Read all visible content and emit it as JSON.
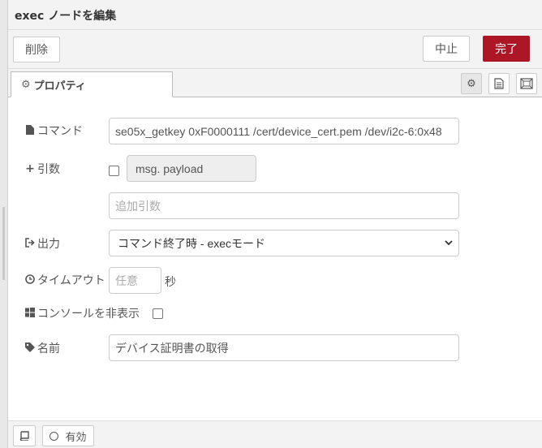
{
  "dialog": {
    "title": "exec ノードを編集"
  },
  "toolbar": {
    "delete_label": "削除",
    "cancel_label": "中止",
    "done_label": "完了"
  },
  "tabs": {
    "properties_label": "プロパティ"
  },
  "side_icons": [
    "gear-icon",
    "document-icon",
    "frame-icon"
  ],
  "form": {
    "command": {
      "label": "コマンド",
      "value": "se05x_getkey 0xF0000111 /cert/device_cert.pem /dev/i2c-6:0x48"
    },
    "args": {
      "label": "引数",
      "checkbox_checked": false,
      "payload_label": "msg. payload",
      "extra_placeholder": "追加引数"
    },
    "output": {
      "label": "出力",
      "selected": "コマンド終了時 - execモード"
    },
    "timeout": {
      "label": "タイムアウト",
      "placeholder": "任意",
      "unit": "秒"
    },
    "hide_console": {
      "label": "コンソールを非表示",
      "checked": false
    },
    "name": {
      "label": "名前",
      "value": "デバイス証明書の取得"
    }
  },
  "footer": {
    "enable_label": "有効"
  },
  "colors": {
    "accent": "#ad1625",
    "chrome": "#f3f3f3"
  }
}
